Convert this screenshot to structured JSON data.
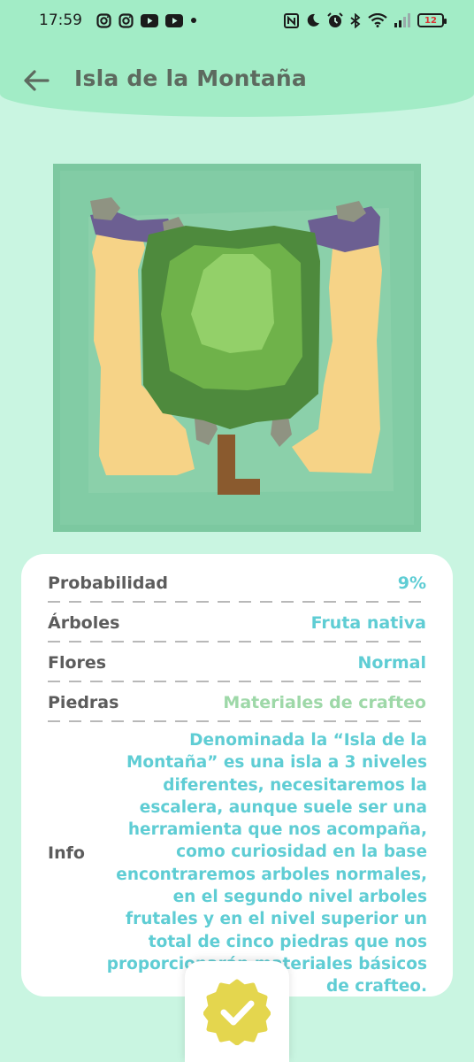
{
  "status_bar": {
    "time": "17:59",
    "battery": "12",
    "left_icons": [
      "instagram-icon",
      "instagram-icon",
      "youtube-icon",
      "youtube-icon",
      "dot-icon"
    ],
    "right_icons": [
      "nfc-icon",
      "moon-icon",
      "alarm-icon",
      "bluetooth-icon",
      "wifi-icon",
      "signal-icon",
      "battery-icon"
    ]
  },
  "header": {
    "title": "Isla de la Montaña",
    "back_icon": "arrow-left-icon",
    "background": "#a2ecc6"
  },
  "island": {
    "image_name": "island-map-image"
  },
  "details": {
    "rows": [
      {
        "label": "Probabilidad",
        "value": "9%"
      },
      {
        "label": "Árboles",
        "value": "Fruta nativa"
      },
      {
        "label": "Flores",
        "value": "Normal"
      },
      {
        "label": "Piedras",
        "value": "Materiales de crafteo"
      }
    ],
    "info_label": "Info",
    "info_text": "Denominada la “Isla de la Montaña” es una isla a 3 niveles diferentes, necesitaremos la escalera, aunque suele ser una herramienta que nos acompaña, como curiosidad en la base encontraremos arboles normales, en el segundo nivel arboles frutales y en el nivel superior un total de cinco piedras que nos proporcionarán materiales básicos de crafteo."
  },
  "fab": {
    "icon": "check-badge-icon"
  },
  "colors": {
    "background": "#c9f5e1",
    "accent_value": "#5fcdd4",
    "label": "#5c5c5c",
    "badge": "#e4d64e"
  }
}
